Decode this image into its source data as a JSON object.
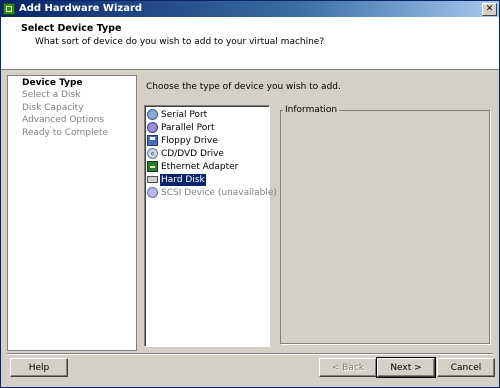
{
  "window": {
    "title": "Add Hardware Wizard",
    "close_glyph": "✕"
  },
  "header": {
    "title": "Select Device Type",
    "subtitle": "What sort of device do you wish to add to your virtual machine?"
  },
  "steps": [
    {
      "label": "Device Type",
      "active": true
    },
    {
      "label": "Select a Disk",
      "active": false
    },
    {
      "label": "Disk Capacity",
      "active": false
    },
    {
      "label": "Advanced Options",
      "active": false
    },
    {
      "label": "Ready to Complete",
      "active": false
    }
  ],
  "main": {
    "prompt": "Choose the type of device you wish to add.",
    "devices": [
      {
        "label": "Serial Port",
        "icon": "serial-port-icon"
      },
      {
        "label": "Parallel Port",
        "icon": "parallel-port-icon"
      },
      {
        "label": "Floppy Drive",
        "icon": "floppy-drive-icon"
      },
      {
        "label": "CD/DVD Drive",
        "icon": "cd-dvd-drive-icon"
      },
      {
        "label": "Ethernet Adapter",
        "icon": "ethernet-adapter-icon"
      },
      {
        "label": "Hard Disk",
        "icon": "hard-disk-icon",
        "selected": true
      },
      {
        "label": "SCSI Device (unavailable)",
        "icon": "scsi-device-icon",
        "disabled": true
      }
    ],
    "info_legend": "Information"
  },
  "footer": {
    "help": "Help",
    "back": "< Back",
    "next": "Next >",
    "cancel": "Cancel"
  }
}
